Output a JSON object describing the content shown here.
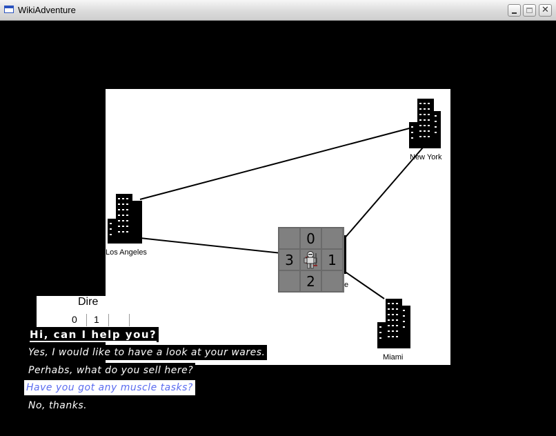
{
  "window": {
    "title": "WikiAdventure",
    "minimize_symbol": "",
    "maximize_symbol": "",
    "close_symbol": "✕"
  },
  "map": {
    "cities": [
      {
        "name": "New York",
        "icon": "building-icon"
      },
      {
        "name": "Los Angeles",
        "icon": "building-icon"
      },
      {
        "name": "Miami",
        "icon": "building-icon"
      },
      {
        "name": "e",
        "icon": "building-icon"
      }
    ],
    "player": {
      "icon": "knight-icon"
    }
  },
  "direction_grid": {
    "up": "0",
    "right": "1",
    "down": "2",
    "left": "3"
  },
  "direction_panel": {
    "title": "Dire",
    "numbers": [
      "0",
      "1"
    ]
  },
  "dialog": {
    "question": "Hi, can I help you?",
    "options": [
      {
        "text": "Yes, I would like to have a look at your wares.",
        "selected": false
      },
      {
        "text": "Perhabs, what do you sell here?",
        "selected": false
      },
      {
        "text": "Have you got any muscle tasks?",
        "selected": true
      },
      {
        "text": "No, thanks.",
        "selected": false
      }
    ]
  },
  "colors": {
    "background": "#000000",
    "map": "#ffffff",
    "selected_option_text": "#5b6cf0",
    "grid_cell": "#808080"
  }
}
